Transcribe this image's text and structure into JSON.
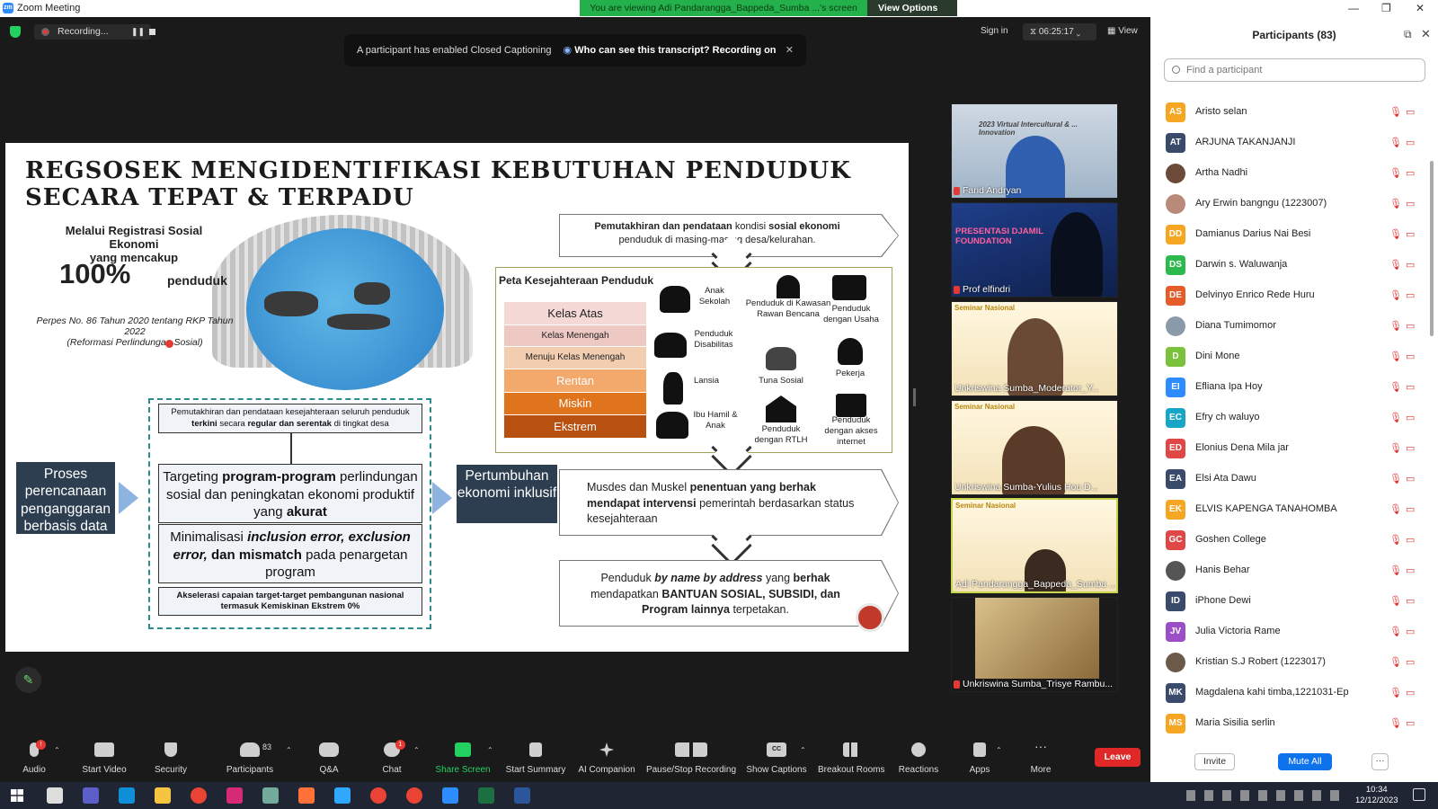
{
  "window": {
    "title": "Zoom Meeting",
    "logo_text": "zm"
  },
  "share_banner": {
    "text": "You are viewing Adi Pandarangga_Bappeda_Sumba ...'s screen",
    "view_options": "View Options"
  },
  "recording": {
    "label": "Recording..."
  },
  "cc_banner": {
    "text": "A participant has enabled Closed Captioning",
    "link": "Who can see this transcript? Recording on",
    "close": "✕"
  },
  "top_right": {
    "sign_in": "Sign in",
    "timer": "06:25:17",
    "view": "View"
  },
  "slide": {
    "title": "REGSOSEK MENGIDENTIFIKASI KEBUTUHAN PENDUDUK SECARA TEPAT & TERPADU",
    "intro_line1": "Melalui Registrasi Sosial Ekonomi",
    "intro_line2": "yang mencakup",
    "percent": "100%",
    "percent_label": "penduduk",
    "perpres_line1": "Perpes No. 86 Tahun 2020 tentang RKP Tahun",
    "perpres_line2": "2022",
    "perpres_line3": "(Reformasi Perlindungan Sosial)",
    "flow1_bold": "Pemutakhiran dan pendataan",
    "flow1_rest1": "kondisi",
    "flow1_bold2": "sosial ekonomi",
    "flow1_rest2": "penduduk di masing-masing desa/kelurahan.",
    "peta_title": "Peta Kesejahteraan Penduduk",
    "classes": [
      "Kelas Atas",
      "Kelas Menengah",
      "Menuju Kelas Menengah",
      "Rentan",
      "Miskin",
      "Ekstrem"
    ],
    "class_colors": [
      "#f4d9d6",
      "#eec8c3",
      "#f2cdb0",
      "#f3a86c",
      "#e0741d",
      "#b8500f"
    ],
    "icons_col1": [
      "Anak Sekolah",
      "Penduduk Disabilitas",
      "Lansia",
      "Ibu Hamil & Anak"
    ],
    "icons_col2": [
      "Penduduk di Kawasan Rawan Bencana",
      "Tuna Sosial",
      "Penduduk dengan RTLH"
    ],
    "icons_col3": [
      "Penduduk dengan Usaha",
      "Pekerja",
      "Penduduk dengan akses internet"
    ],
    "flow2_t1": "Musdes dan Muskel",
    "flow2_b1": "penentuan yang berhak mendapat intervensi",
    "flow2_t2": "pemerintah berdasarkan status kesejahteraan",
    "flow3_t1": "Penduduk",
    "flow3_b1": "by name by address",
    "flow3_t2": "yang",
    "flow3_b2": "berhak",
    "flow3_t3": "mendapatkan",
    "flow3_b3": "BANTUAN SOSIAL, SUBSIDI, dan Program lainnya",
    "flow3_t4": "terpetakan.",
    "box_pemutakhiran_1": "Pemutakhiran dan pendataan kesejahteraan seluruh penduduk",
    "box_pemutakhiran_b1": "terkini",
    "box_pemutakhiran_2": "secara",
    "box_pemutakhiran_b2": "regular dan serentak",
    "box_pemutakhiran_3": "di tingkat desa",
    "targeting_1": "Targeting",
    "targeting_b1": "program-program",
    "targeting_2": "perlindungan sosial dan peningkatan ekonomi produktif yang",
    "targeting_b2": "akurat",
    "minimal_1": "Minimalisasi",
    "minimal_b1": "inclusion error, exclusion error,",
    "minimal_b2": "dan mismatch",
    "minimal_2": "pada penargetan program",
    "akselerasi": "Akselerasi capaian target-target pembangunan nasional termasuk Kemiskinan Ekstrem 0%",
    "proses": "Proses perencanaan penganggaran berbasis data",
    "pertumbuhan": "Pertumbuhan ekonomi inklusif"
  },
  "video_tiles": [
    {
      "name": "Farid Andryan",
      "overlay": "2023 Virtual Intercultural & ... Innovation",
      "muted": true
    },
    {
      "name": "Prof elfindri",
      "overlay": "PRESENTASI DJAMIL FOUNDATION",
      "muted": true
    },
    {
      "name": "Unkriswina Sumba_Moderator_Y...",
      "overlay": "Seminar Nasional",
      "muted": false
    },
    {
      "name": "Unkriswina Sumba-Yulius Hou D...",
      "overlay": "Seminar Nasional",
      "muted": false
    },
    {
      "name": "Adi Pandarangga_Bappeda_Sumba ...",
      "overlay": "Seminar Nasional",
      "muted": false
    },
    {
      "name": "Unkriswina Sumba_Trisye Rambu...",
      "overlay": "",
      "muted": true
    }
  ],
  "participants_panel": {
    "title": "Participants (83)",
    "search_placeholder": "Find a participant",
    "invite": "Invite",
    "mute_all": "Mute All",
    "more": "···",
    "list": [
      {
        "initials": "AS",
        "name": "Aristo selan",
        "color": "#f5a623"
      },
      {
        "initials": "AT",
        "name": "ARJUNA TAKANJANJI",
        "color": "#3a4a6b"
      },
      {
        "initials": "",
        "name": "Artha Nadhi",
        "color": "#6b4a3a"
      },
      {
        "initials": "",
        "name": "Ary Erwin bangngu (1223007)",
        "color": "#b98a7a"
      },
      {
        "initials": "DD",
        "name": "Damianus Darius Nai Besi",
        "color": "#f5a623"
      },
      {
        "initials": "DS",
        "name": "Darwin s. Waluwanja",
        "color": "#2cba4e"
      },
      {
        "initials": "DE",
        "name": "Delvinyo Enrico Rede Huru",
        "color": "#e55b2a"
      },
      {
        "initials": "",
        "name": "Diana Tumimomor",
        "color": "#8a9aa8"
      },
      {
        "initials": "D",
        "name": "Dini Mone",
        "color": "#7cc13b"
      },
      {
        "initials": "EI",
        "name": "Efliana Ipa Hoy",
        "color": "#2d8cff"
      },
      {
        "initials": "EC",
        "name": "Efry ch waluyo",
        "color": "#17a6c8"
      },
      {
        "initials": "ED",
        "name": "Elonius Dena Mila jar",
        "color": "#e04848"
      },
      {
        "initials": "EA",
        "name": "Elsi Ata Dawu",
        "color": "#3a4a6b"
      },
      {
        "initials": "EK",
        "name": "ELVIS KAPENGA TANAHOMBA",
        "color": "#f5a623"
      },
      {
        "initials": "GC",
        "name": "Goshen College",
        "color": "#e04848"
      },
      {
        "initials": "",
        "name": "Hanis Behar",
        "color": "#555555"
      },
      {
        "initials": "ID",
        "name": "iPhone Dewi",
        "color": "#3a4a6b"
      },
      {
        "initials": "JV",
        "name": "Julia Victoria Rame",
        "color": "#9b4fc7"
      },
      {
        "initials": "",
        "name": "Kristian S.J Robert (1223017)",
        "color": "#6b5a4a"
      },
      {
        "initials": "MK",
        "name": "Magdalena kahi timba,1221031-Ep",
        "color": "#3a4a6b"
      },
      {
        "initials": "MS",
        "name": "Maria Sisilia serlin",
        "color": "#f5a623"
      }
    ]
  },
  "toolbar": {
    "audio": "Audio",
    "audio_badge": "!",
    "start_video": "Start Video",
    "security": "Security",
    "participants": "Participants",
    "participants_count": "83",
    "qa": "Q&A",
    "chat": "Chat",
    "chat_badge": "1",
    "share_screen": "Share Screen",
    "start_summary": "Start Summary",
    "ai_companion": "AI Companion",
    "pause_stop": "Pause/Stop Recording",
    "show_captions": "Show Captions",
    "breakout": "Breakout Rooms",
    "reactions": "Reactions",
    "apps": "Apps",
    "more": "More",
    "leave": "Leave",
    "cc_icon_text": "CC"
  },
  "taskbar": {
    "time": "10:34",
    "date": "12/12/2023",
    "apps": [
      "Search",
      "Teams",
      "Edge",
      "Explorer",
      "Chrome",
      "Instagram",
      "ChatGPT",
      "Firefox",
      "Photoshop",
      "Chrome 2",
      "Chrome 3",
      "Zoom",
      "Excel",
      "Word"
    ]
  }
}
